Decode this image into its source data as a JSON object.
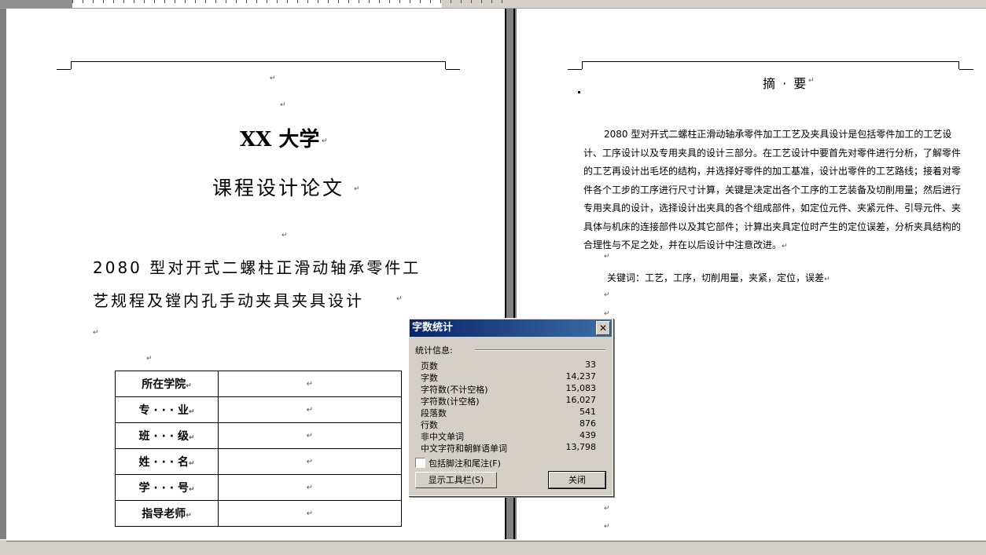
{
  "left_page": {
    "university": "XX 大学",
    "course_title": "课程设计论文",
    "subject_line1": "2080 型对开式二螺柱正滑动轴承零件工",
    "subject_line2": "艺规程及镗内孔手动夹具夹具设计",
    "info_table": [
      {
        "label": "所在学院",
        "value": ""
      },
      {
        "label": "专 · · · 业",
        "value": ""
      },
      {
        "label": "班 · · · 级",
        "value": ""
      },
      {
        "label": "姓 · · · 名",
        "value": ""
      },
      {
        "label": "学 · · · 号",
        "value": ""
      },
      {
        "label": "指导老师",
        "value": ""
      }
    ]
  },
  "right_page": {
    "abstract_title": "摘 · 要",
    "abstract_body": "2080 型对开式二螺柱正滑动轴承零件加工工艺及夹具设计是包括零件加工的工艺设计、工序设计以及专用夹具的设计三部分。在工艺设计中要首先对零件进行分析，了解零件的工艺再设计出毛坯的结构，并选择好零件的加工基准，设计出零件的工艺路线；接着对零件各个工步的工序进行尺寸计算，关键是决定出各个工序的工艺装备及切削用量；然后进行专用夹具的设计，选择设计出夹具的各个组成部件，如定位元件、夹紧元件、引导元件、夹具体与机床的连接部件以及其它部件；计算出夹具定位时产生的定位误差，分析夹具结构的合理性与不足之处，并在以后设计中注意改进。",
    "keywords": "关键词：工艺，工序，切削用量，夹紧，定位，误差"
  },
  "para_mark": "↵",
  "dialog": {
    "title": "字数统计",
    "close_glyph": "✕",
    "group_label": "统计信息:",
    "stats": [
      {
        "label": "页数",
        "value": "33"
      },
      {
        "label": "字数",
        "value": "14,237"
      },
      {
        "label": "字符数(不计空格)",
        "value": "15,083"
      },
      {
        "label": "字符数(计空格)",
        "value": "16,027"
      },
      {
        "label": "段落数",
        "value": "541"
      },
      {
        "label": "行数",
        "value": "876"
      },
      {
        "label": "非中文单词",
        "value": "439"
      },
      {
        "label": "中文字符和朝鲜语单词",
        "value": "13,798"
      }
    ],
    "checkbox_label": "包括脚注和尾注(F)",
    "toolbar_button": "显示工具栏(S)",
    "close_button": "关闭"
  },
  "colors": {
    "titlebar_start": "#0a246a",
    "titlebar_end": "#3a6ea5",
    "dialog_bg": "#d4d0c8"
  }
}
